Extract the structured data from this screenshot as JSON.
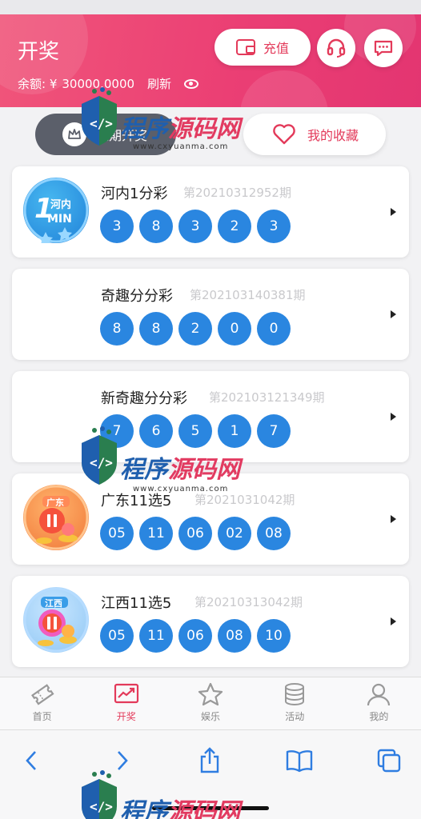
{
  "header": {
    "title": "开奖",
    "balance_label": "余额: ¥",
    "balance_value": "30000.0000",
    "refresh_label": "刷新",
    "recharge_label": "充值"
  },
  "tabs": {
    "recent_label": "近期开奖",
    "favorites_label": "我的收藏"
  },
  "lotteries": [
    {
      "name": "河内1分彩",
      "issue": "第20210312952期",
      "numbers": [
        "3",
        "8",
        "3",
        "2",
        "3"
      ],
      "logo_text": "1 河内 MIN"
    },
    {
      "name": "奇趣分分彩",
      "issue": "第202103140381期",
      "numbers": [
        "8",
        "8",
        "2",
        "0",
        "0"
      ]
    },
    {
      "name": "新奇趣分分彩",
      "issue": "第202103121349期",
      "numbers": [
        "7",
        "6",
        "5",
        "1",
        "7"
      ]
    },
    {
      "name": "广东11选5",
      "issue": "第2021031042期",
      "numbers": [
        "05",
        "11",
        "06",
        "02",
        "08"
      ],
      "logo_text": "广东"
    },
    {
      "name": "江西11选5",
      "issue": "第20210313042期",
      "numbers": [
        "05",
        "11",
        "06",
        "08",
        "10"
      ],
      "logo_text": "江西"
    }
  ],
  "tabbar": [
    {
      "label": "首页",
      "icon": "ticket-icon"
    },
    {
      "label": "开奖",
      "icon": "trend-chart-icon",
      "active": true
    },
    {
      "label": "娱乐",
      "icon": "star-icon"
    },
    {
      "label": "活动",
      "icon": "coins-icon"
    },
    {
      "label": "我的",
      "icon": "user-icon"
    }
  ],
  "watermark": {
    "text_a": "程序",
    "text_b": "源码网",
    "url": "www.cxyuanma.com"
  },
  "colors": {
    "header": "#eb3f74",
    "accent": "#e33a5a",
    "ball": "#2a86e0"
  }
}
